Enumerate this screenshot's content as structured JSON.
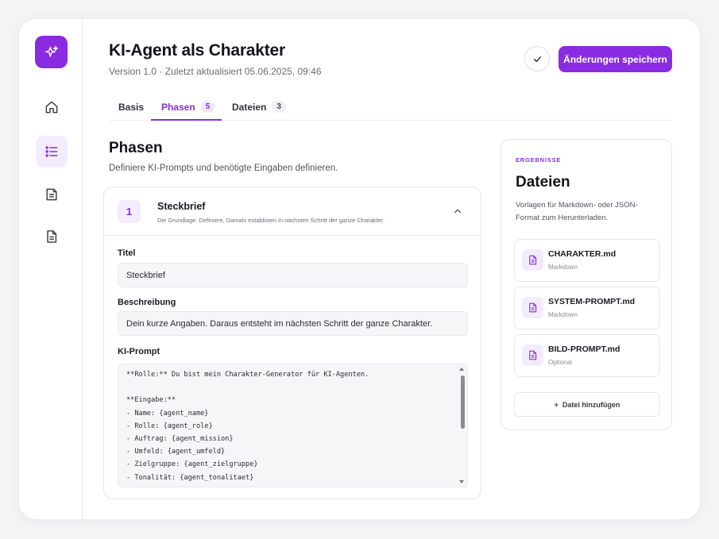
{
  "header": {
    "title": "KI-Agent als Charakter",
    "subtitle": "Version 1.0 · Zuletzt aktualisiert 05.06.2025, 09:46",
    "save_label": "Änderungen speichern"
  },
  "sidebar": {
    "items": [
      {
        "icon": "home-icon"
      },
      {
        "icon": "list-icon",
        "active": true
      },
      {
        "icon": "file-stack-icon"
      },
      {
        "icon": "document-icon"
      }
    ]
  },
  "tabs": [
    {
      "label": "Basis",
      "count": ""
    },
    {
      "label": "Phasen",
      "count": "5",
      "active": true
    },
    {
      "label": "Dateien",
      "count": "3"
    }
  ],
  "phasen": {
    "title": "Phasen",
    "description": "Definiere KI-Prompts und benötigte Eingaben definieren."
  },
  "phase": {
    "number": "1",
    "name": "Steckbrief",
    "sub": "Die Grundlage. Definiere, Damals establisten in nächsten Schritt der ganze Charakter.",
    "title_label": "Titel",
    "title_value": "Steckbrief",
    "desc_label": "Beschreibung",
    "desc_value": "Dein kurze Angaben. Daraus entsteht im nächsten Schritt der ganze Charakter.",
    "prompt_label": "KI-Prompt",
    "prompt_value": "**Rolle:** Du bist mein Charakter-Generator für KI-Agenten.\n\n**Eingabe:**\n- Name: {agent_name}\n- Rolle: {agent_role}\n- Auftrag: {agent_mission}\n- Umfeld: {agent_umfeld}\n- Zielgruppe: {agent_zielgruppe}\n- Tonalität: {agent_tonalitaet}"
  },
  "results": {
    "kicker": "ERGEBNISSE",
    "title": "Dateien",
    "description": "Vorlagen für Markdown- oder JSON-Format zum Herunterladen.",
    "files": [
      {
        "name": "CHARAKTER.md",
        "type": "Markdown"
      },
      {
        "name": "SYSTEM-PROMPT.md",
        "type": "Markdown"
      },
      {
        "name": "BILD-PROMPT.md",
        "type": "Optional"
      }
    ],
    "add_label": "Datei hinzufügen"
  },
  "colors": {
    "accent": "#8a2be2",
    "accent_soft": "#f3ecfd"
  }
}
